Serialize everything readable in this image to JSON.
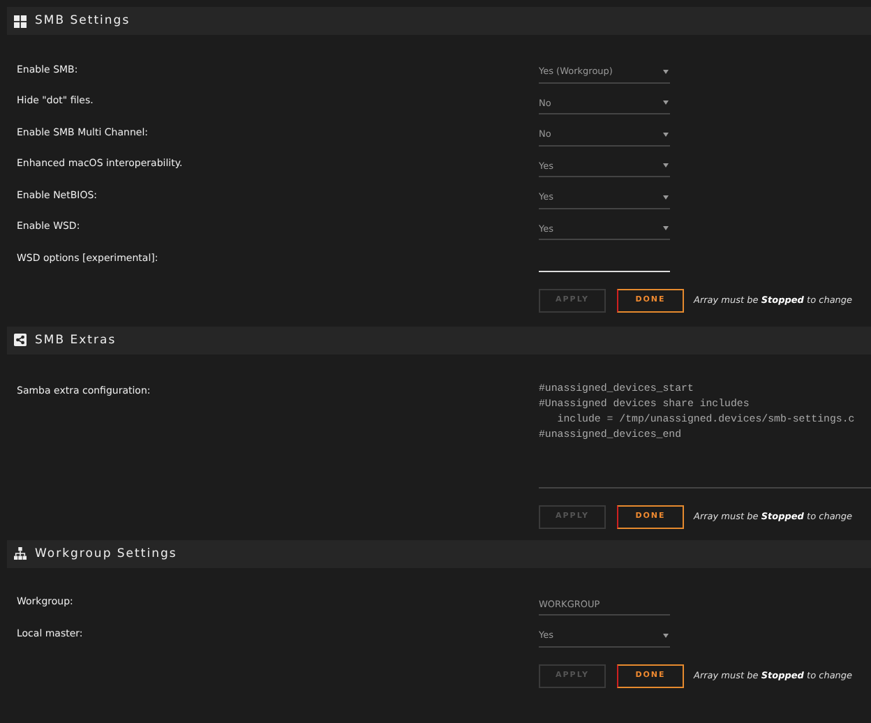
{
  "sections": [
    {
      "title": "SMB Settings",
      "fields": [
        {
          "label": "Enable SMB:",
          "kind": "select",
          "value": "Yes (Workgroup)"
        },
        {
          "label": "Hide \"dot\" files.",
          "kind": "select",
          "value": "No"
        },
        {
          "label": "Enable SMB Multi Channel:",
          "kind": "select",
          "value": "No"
        },
        {
          "label": "Enhanced macOS interoperability.",
          "kind": "select",
          "value": "Yes"
        },
        {
          "label": "Enable NetBIOS:",
          "kind": "select",
          "value": "Yes"
        },
        {
          "label": "Enable WSD:",
          "kind": "select",
          "value": "Yes"
        },
        {
          "label": "WSD options [experimental]:",
          "kind": "text",
          "focused": true
        }
      ],
      "buttons": [
        {
          "label": "APPLY",
          "disabled": true
        },
        {
          "label": "DONE",
          "disabled": false
        }
      ],
      "note": "Array must be **Stopped** to change"
    },
    {
      "title": "SMB Extras",
      "fields": [
        {
          "label": "Samba extra configuration:",
          "kind": "textarea",
          "lines": [
            "#unassigned_devices_start",
            "#Unassigned devices share includes",
            "   include = /tmp/unassigned.devices/smb-settings.c",
            "#unassigned_devices_end"
          ]
        }
      ],
      "buttons": [
        {
          "label": "APPLY",
          "disabled": true
        },
        {
          "label": "DONE",
          "disabled": false
        }
      ],
      "note": "Array must be **Stopped** to change"
    },
    {
      "title": "Workgroup Settings",
      "fields": [
        {
          "label": "Workgroup:",
          "kind": "text",
          "value": "WORKGROUP",
          "focused": false
        },
        {
          "label": "Local master:",
          "kind": "select",
          "value": "Yes"
        }
      ],
      "buttons": [
        {
          "label": "APPLY",
          "disabled": true
        },
        {
          "label": "DONE",
          "disabled": false
        }
      ],
      "note": "Array must be **Stopped** to change"
    }
  ]
}
